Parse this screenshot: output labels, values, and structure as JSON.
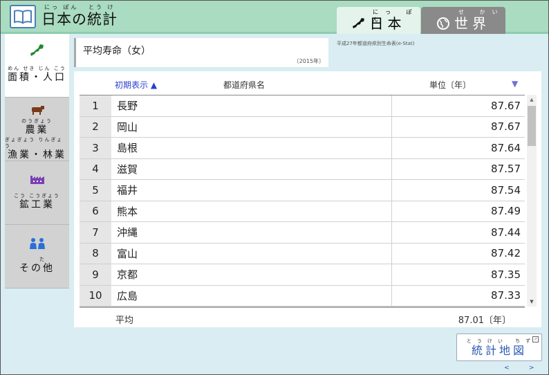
{
  "header": {
    "app_title": "日本の統計",
    "app_title_ruby": [
      "にっ ぽん",
      "とう けい"
    ],
    "tabs": [
      {
        "label": "日本",
        "ruby": "にっ ぽん",
        "active": true
      },
      {
        "label": "世界",
        "ruby": "せ かい",
        "active": false
      }
    ]
  },
  "sidebar": {
    "items": [
      {
        "ruby": "めん せき じん こう",
        "label": "面積・人口",
        "icon": "japan-map-icon",
        "active": true
      },
      {
        "ruby": "のうぎょう",
        "label": "農業",
        "ruby2": "ぎょぎょう りんぎょう",
        "label2": "漁業・林業",
        "icon": "cow-icon",
        "active": false
      },
      {
        "ruby": "こう こうぎょう",
        "label": "鉱工業",
        "icon": "factory-icon",
        "active": false
      },
      {
        "ruby": "た",
        "label": "その他",
        "icon": "people-icon",
        "active": false
      }
    ]
  },
  "indicator": {
    "title": "平均寿命（女）",
    "year": "〔2015年〕",
    "source": "平成27年都道府県別生命表(e-Stat)"
  },
  "table": {
    "sort_initial_label": "初期表示 ▲",
    "column_prefecture": "都道府県名",
    "column_unit": "単位〔年〕",
    "sort_desc_label": "▼",
    "rows": [
      {
        "rank": "1",
        "prefecture": "長野",
        "value": "87.67"
      },
      {
        "rank": "2",
        "prefecture": "岡山",
        "value": "87.67"
      },
      {
        "rank": "3",
        "prefecture": "島根",
        "value": "87.64"
      },
      {
        "rank": "4",
        "prefecture": "滋賀",
        "value": "87.57"
      },
      {
        "rank": "5",
        "prefecture": "福井",
        "value": "87.54"
      },
      {
        "rank": "6",
        "prefecture": "熊本",
        "value": "87.49"
      },
      {
        "rank": "7",
        "prefecture": "沖縄",
        "value": "87.44"
      },
      {
        "rank": "8",
        "prefecture": "富山",
        "value": "87.42"
      },
      {
        "rank": "9",
        "prefecture": "京都",
        "value": "87.35"
      },
      {
        "rank": "10",
        "prefecture": "広島",
        "value": "87.33"
      }
    ],
    "average_label": "平均",
    "average_value": "87.01〔年〕"
  },
  "stat_map": {
    "ruby": "とうけい ちず",
    "label": "統計地図"
  },
  "nav": {
    "prev": "<",
    "next": ">"
  },
  "colors": {
    "header_bg": "#a9dcc0",
    "page_bg": "#d9edf2",
    "link_blue": "#2a3fd0",
    "icon_green": "#1f8a2e",
    "icon_brown": "#7a3a1a",
    "icon_purple": "#7b3fb3",
    "icon_blue": "#2a6fd6"
  }
}
